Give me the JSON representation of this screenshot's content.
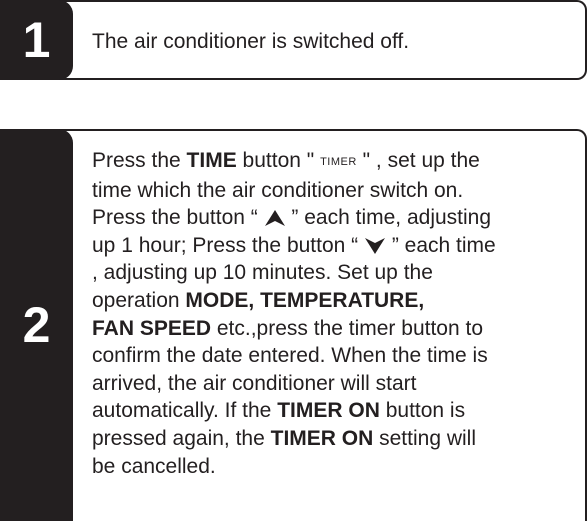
{
  "step1": {
    "number": "1",
    "text": "The air conditioner is switched off."
  },
  "step2": {
    "number": "2",
    "line1_a": "Press the ",
    "line1_b": "TIME",
    "line1_c": " button \" ",
    "line1_timer": "TIMER",
    "line1_d": " \" , set up the",
    "line2": "time which the air conditioner switch on.",
    "line3_a": "Press the button “ ",
    "up_icon": "up-arrow-icon",
    "line3_b": " ” each time, adjusting",
    "line4_a": "up 1 hour; Press the button “ ",
    "down_icon": "down-arrow-icon",
    "line4_b": " ” each time",
    "line5": ", adjusting up 10 minutes. Set up the",
    "line6_a": "operation ",
    "line6_b": "MODE, TEMPERATURE,",
    "line7_a": "FAN SPEED",
    "line7_b": " etc.,press the timer button to",
    "line8": "confirm the date entered. When the time is",
    "line9": "arrived, the air conditioner will start",
    "line10_a": "automatically. If the ",
    "line10_b": "TIMER ON",
    "line10_c": " button is",
    "line11_a": "pressed again, the ",
    "line11_b": "TIMER ON",
    "line11_c": " setting will",
    "line12": "be cancelled."
  }
}
